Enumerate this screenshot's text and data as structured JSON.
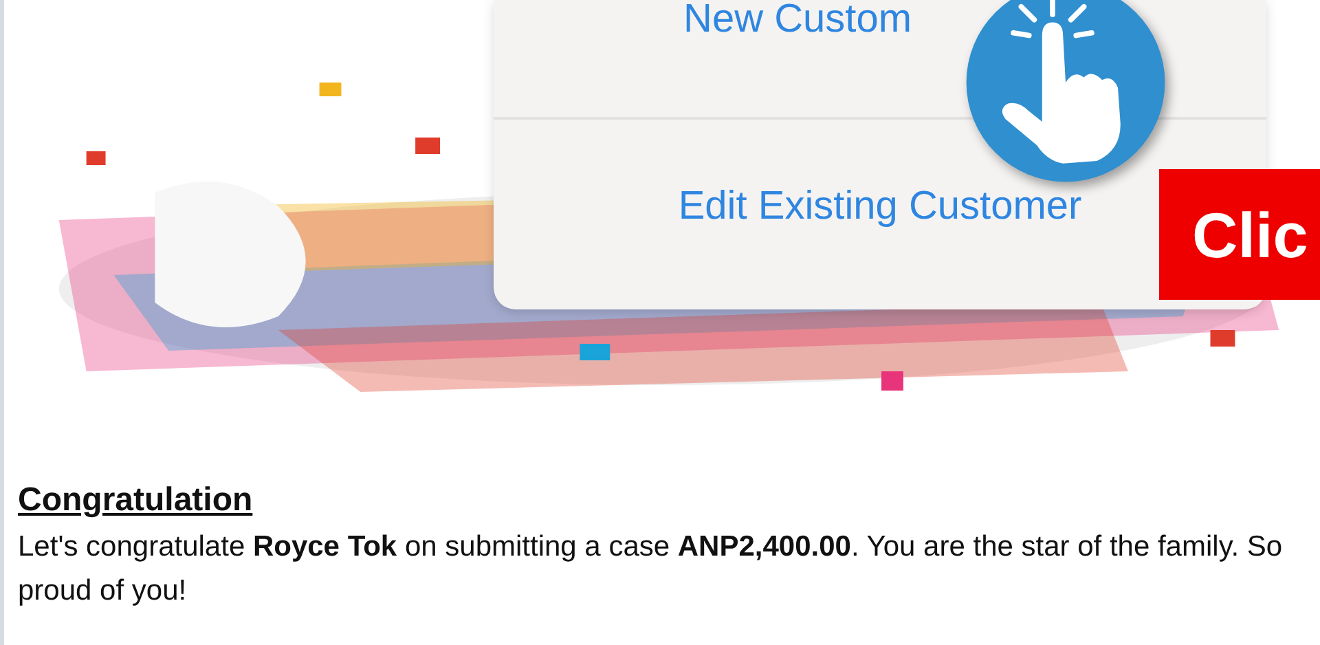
{
  "menu": {
    "items": [
      {
        "label": "New Custom"
      },
      {
        "label": "Edit Existing Customer"
      }
    ]
  },
  "badge": {
    "label": "Clic"
  },
  "message": {
    "title": "Congratulation",
    "body": "Let's congratulate **Royce Tok** on submitting a case **ANP2,400.00**. You are the star of the family. So proud of you!"
  }
}
